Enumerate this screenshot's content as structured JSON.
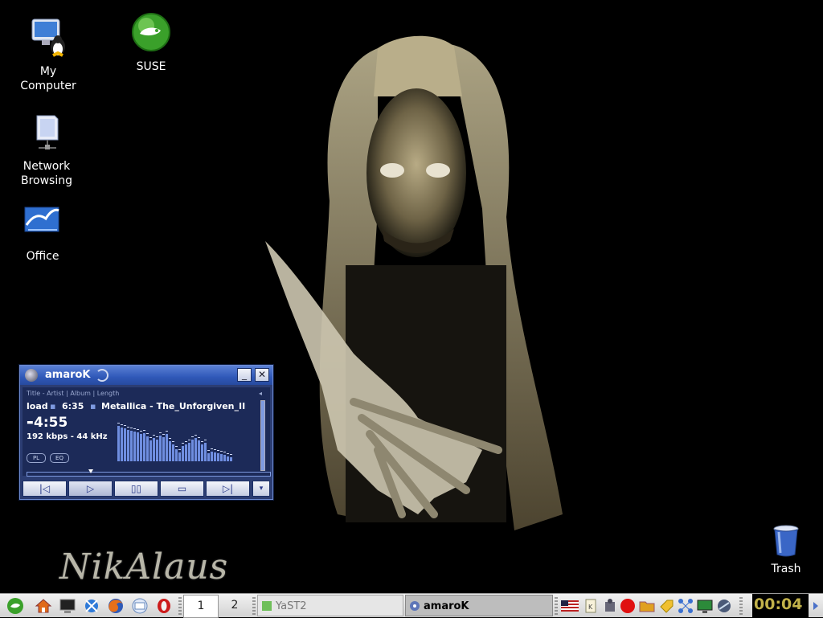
{
  "desktop": {
    "signature": "NikAlaus",
    "icons": [
      {
        "label_line1": "My",
        "label_line2": "Computer",
        "icon": "my-computer-icon"
      },
      {
        "label_line1": "SUSE",
        "label_line2": "",
        "icon": "suse-icon"
      },
      {
        "label_line1": "Network",
        "label_line2": "Browsing",
        "icon": "network-browsing-icon"
      },
      {
        "label_line1": "Office",
        "label_line2": "",
        "icon": "office-icon"
      },
      {
        "label_line1": "Trash",
        "label_line2": "",
        "icon": "trash-icon"
      }
    ]
  },
  "amarok": {
    "title": "amaroK",
    "header_hint": "Title - Artist | Album | Length",
    "scroll_left": "load",
    "track_length": "6:35",
    "track_title": "Metallica - The_Unforgiven_II",
    "elapsed": "4:55",
    "bitrate": "192 kbps - 44 kHz",
    "pl_label": "PL",
    "eq_label": "EQ",
    "progress": 0.25,
    "analyzer_levels": [
      0.85,
      0.8,
      0.78,
      0.75,
      0.74,
      0.72,
      0.7,
      0.66,
      0.68,
      0.6,
      0.5,
      0.55,
      0.52,
      0.62,
      0.58,
      0.66,
      0.48,
      0.4,
      0.28,
      0.22,
      0.36,
      0.4,
      0.44,
      0.52,
      0.55,
      0.5,
      0.4,
      0.45,
      0.2,
      0.24,
      0.22,
      0.2,
      0.18,
      0.16,
      0.12,
      0.1
    ],
    "controls": [
      "prev",
      "play",
      "pause",
      "stop",
      "next"
    ],
    "accent": "#2c3d72"
  },
  "taskbar": {
    "launchers": [
      "suse-menu-icon",
      "home-icon",
      "terminal-icon",
      "kde-icon",
      "firefox-icon",
      "mail-icon",
      "opera-icon"
    ],
    "pager": [
      "1",
      "2"
    ],
    "tasks": [
      {
        "label": "YaST2",
        "active": false
      },
      {
        "label": "amaroK",
        "active": true
      }
    ],
    "tray": [
      "us-flag-icon",
      "klipper-icon",
      "network-icon",
      "record-icon",
      "folder-icon",
      "tag-icon",
      "grid-icon",
      "monitor-icon",
      "satellite-icon"
    ],
    "clock": "00:04"
  }
}
